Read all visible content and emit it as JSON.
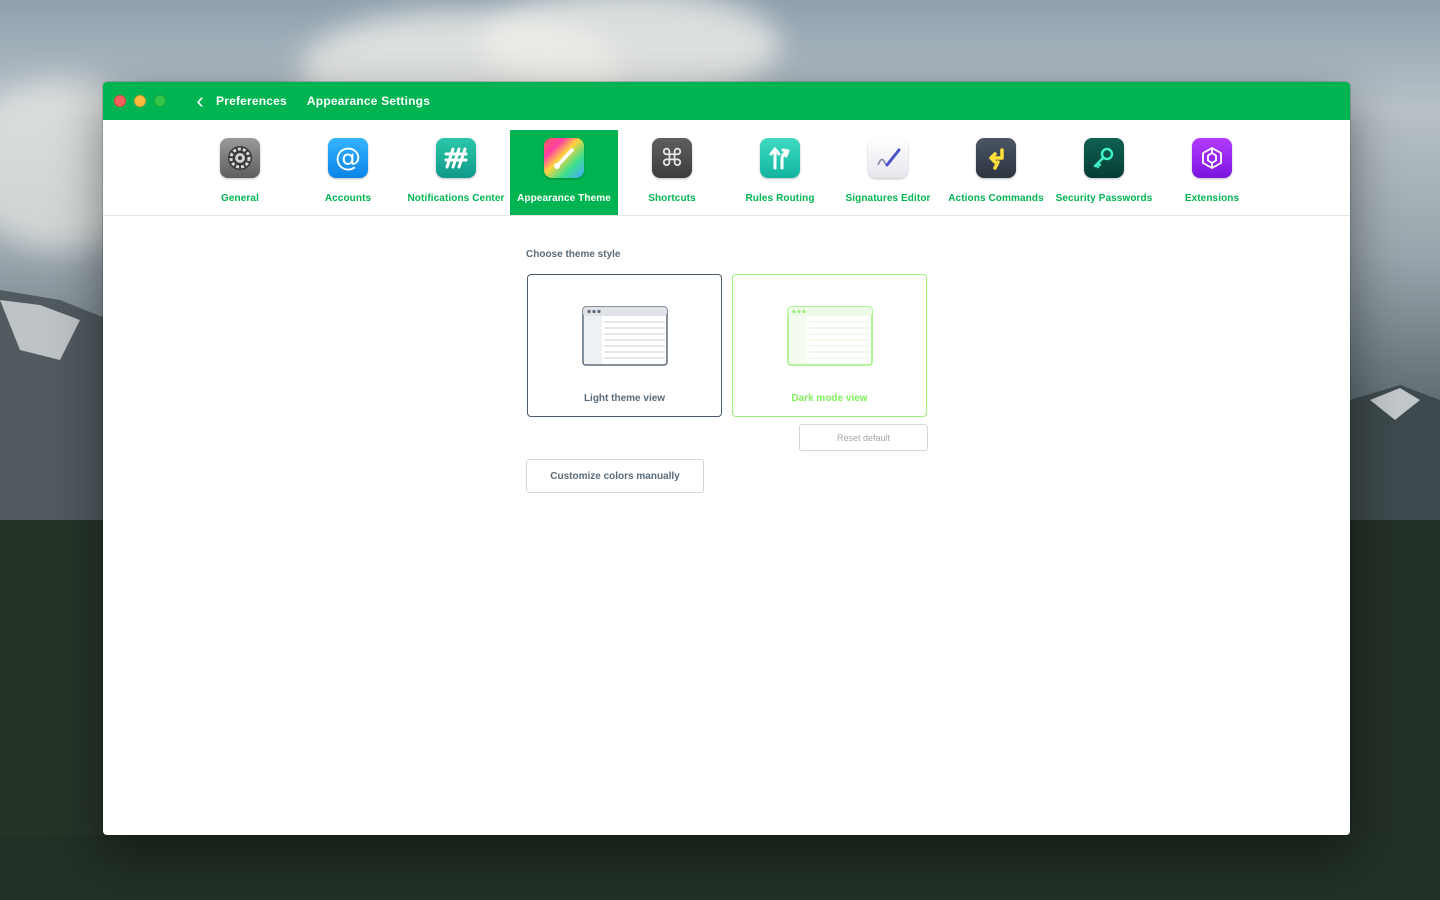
{
  "window": {
    "title_primary": "Preferences",
    "title_secondary": "Appearance Settings"
  },
  "tabs": [
    {
      "label": "General",
      "icon": "gear-icon",
      "color": "#6d6d6d",
      "active": false
    },
    {
      "label": "Accounts",
      "icon": "at-sign-icon",
      "color": "#1e9bf5",
      "active": false
    },
    {
      "label": "Notifications Center",
      "icon": "stripes-icon",
      "color": "#17b39a",
      "active": false
    },
    {
      "label": "Appearance Theme",
      "icon": "paintbrush-icon",
      "color": "#e94c8c",
      "active": true
    },
    {
      "label": "Shortcuts",
      "icon": "command-icon",
      "color": "#4f4f4f",
      "active": false
    },
    {
      "label": "Rules Routing",
      "icon": "split-arrows-icon",
      "color": "#17c2a8",
      "active": false
    },
    {
      "label": "Signatures Editor",
      "icon": "pen-signature-icon",
      "color": "#f1f1f5",
      "active": false
    },
    {
      "label": "Actions Commands",
      "icon": "return-arrow-icon",
      "color": "#3e4756",
      "active": false
    },
    {
      "label": "Security Passwords",
      "icon": "key-icon",
      "color": "#0a5046",
      "active": false
    },
    {
      "label": "Extensions",
      "icon": "cube-icon",
      "color": "#8a2be2",
      "active": false
    }
  ],
  "content": {
    "section_title": "Choose theme style",
    "options": [
      {
        "label": "Light theme view",
        "kind": "light"
      },
      {
        "label": "Dark mode view",
        "kind": "dark"
      }
    ],
    "small_button": "Reset default",
    "wide_button": "Customize colors manually"
  }
}
